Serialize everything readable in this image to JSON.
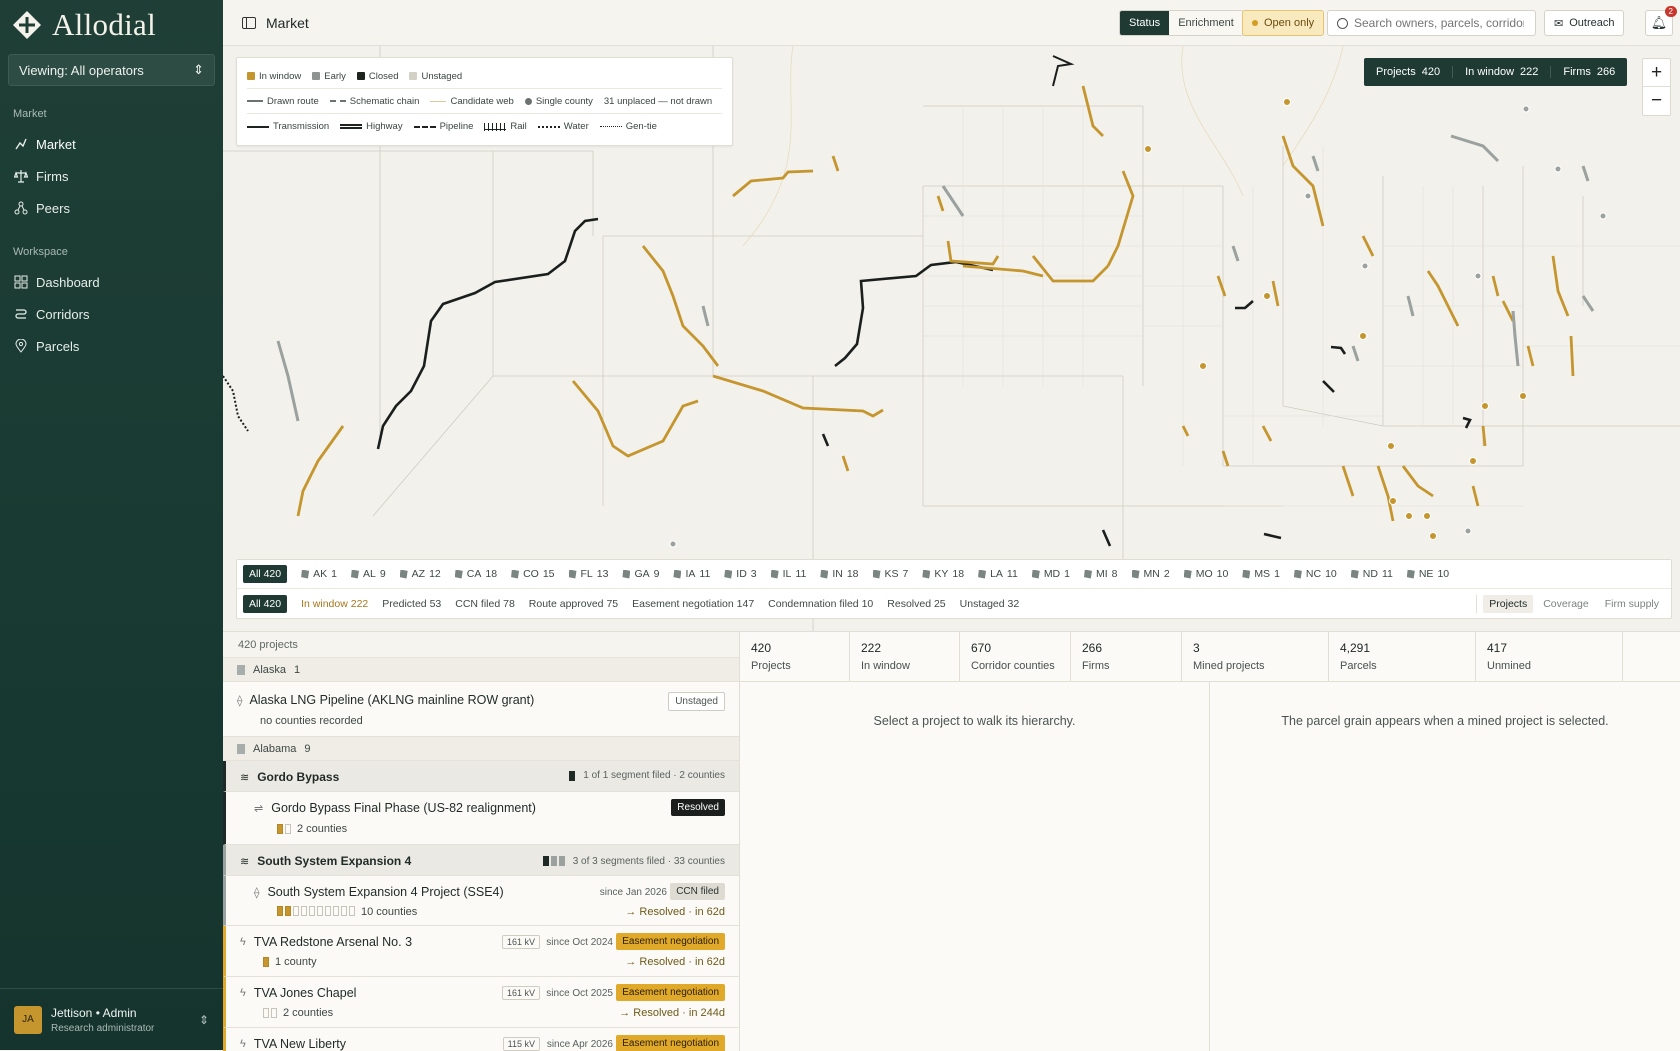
{
  "app": {
    "name": "Allodial",
    "viewing": "Viewing: All operators"
  },
  "nav": {
    "market_section": "Market",
    "workspace_section": "Workspace",
    "items": [
      {
        "label": "Market",
        "icon": "market-icon"
      },
      {
        "label": "Firms",
        "icon": "scale-icon"
      },
      {
        "label": "Peers",
        "icon": "peers-icon"
      },
      {
        "label": "Dashboard",
        "icon": "dashboard-icon"
      },
      {
        "label": "Corridors",
        "icon": "corridors-icon"
      },
      {
        "label": "Parcels",
        "icon": "pin-icon"
      }
    ]
  },
  "user": {
    "initials": "JA",
    "name": "Jettison • Admin",
    "role": "Research administrator"
  },
  "topbar": {
    "title": "Market",
    "mode_status": "Status",
    "mode_enrichment": "Enrichment",
    "open_only": "Open only",
    "search_placeholder": "Search owners, parcels, corridors",
    "outreach": "Outreach",
    "notifications": "2"
  },
  "legend": {
    "status": [
      "In window",
      "Early",
      "Closed",
      "Unstaged"
    ],
    "status_colors": [
      "#c5952e",
      "#8d9491",
      "#1d2420",
      "#d3d0c6"
    ],
    "shape": [
      "Drawn route",
      "Schematic chain",
      "Candidate web",
      "Single county",
      "31 unplaced — not drawn"
    ],
    "types": [
      "Transmission",
      "Highway",
      "Pipeline",
      "Rail",
      "Water",
      "Gen-tie"
    ]
  },
  "stats": {
    "projects_label": "Projects",
    "projects": "420",
    "window_label": "In window",
    "window": "222",
    "firms_label": "Firms",
    "firms": "266"
  },
  "state_filters": [
    {
      "label": "All",
      "count": "420"
    },
    {
      "label": "AK",
      "count": "1"
    },
    {
      "label": "AL",
      "count": "9"
    },
    {
      "label": "AZ",
      "count": "12"
    },
    {
      "label": "CA",
      "count": "18"
    },
    {
      "label": "CO",
      "count": "15"
    },
    {
      "label": "FL",
      "count": "13"
    },
    {
      "label": "GA",
      "count": "9"
    },
    {
      "label": "IA",
      "count": "11"
    },
    {
      "label": "ID",
      "count": "3"
    },
    {
      "label": "IL",
      "count": "11"
    },
    {
      "label": "IN",
      "count": "18"
    },
    {
      "label": "KS",
      "count": "7"
    },
    {
      "label": "KY",
      "count": "18"
    },
    {
      "label": "LA",
      "count": "11"
    },
    {
      "label": "MD",
      "count": "1"
    },
    {
      "label": "MI",
      "count": "8"
    },
    {
      "label": "MN",
      "count": "2"
    },
    {
      "label": "MO",
      "count": "10"
    },
    {
      "label": "MS",
      "count": "1"
    },
    {
      "label": "NC",
      "count": "10"
    },
    {
      "label": "ND",
      "count": "11"
    },
    {
      "label": "NE",
      "count": "10"
    }
  ],
  "stage_filters": [
    {
      "label": "All",
      "count": "420"
    },
    {
      "label": "In window",
      "count": "222"
    },
    {
      "label": "Predicted",
      "count": "53"
    },
    {
      "label": "CCN filed",
      "count": "78"
    },
    {
      "label": "Route approved",
      "count": "75"
    },
    {
      "label": "Easement negotiation",
      "count": "147"
    },
    {
      "label": "Condemnation filed",
      "count": "10"
    },
    {
      "label": "Resolved",
      "count": "25"
    },
    {
      "label": "Unstaged",
      "count": "32"
    }
  ],
  "view_tabs": [
    "Projects",
    "Coverage",
    "Firm supply"
  ],
  "list": {
    "count": "420 projects",
    "groups": [
      {
        "state": "Alaska",
        "count": "1"
      },
      {
        "state": "Alabama",
        "count": "9"
      }
    ],
    "alaska_item": {
      "title": "Alaska LNG Pipeline (AKLNG mainline ROW grant)",
      "badge": "Unstaged",
      "sub": "no counties recorded"
    },
    "gordo_parent": {
      "title": "Gordo Bypass",
      "meta": "1 of 1 segment filed · 2 counties"
    },
    "gordo_child": {
      "title": "Gordo Bypass Final Phase (US-82 realignment)",
      "badge": "Resolved",
      "sub": "2 counties"
    },
    "sse_parent": {
      "title": "South System Expansion 4",
      "meta": "3 of 3 segments filed · 33 counties"
    },
    "sse_child": {
      "title": "South System Expansion 4 Project (SSE4)",
      "since": "since Jan 2026",
      "badge": "CCN filed",
      "sub": "10 counties",
      "res": "→ Resolved · in 62d"
    },
    "tva1": {
      "title": "TVA Redstone Arsenal No. 3",
      "kv": "161 kV",
      "since": "since Oct 2024",
      "badge": "Easement negotiation",
      "sub": "1 county",
      "res": "→ Resolved · in 62d"
    },
    "tva2": {
      "title": "TVA Jones Chapel",
      "kv": "161 kV",
      "since": "since Oct 2025",
      "badge": "Easement negotiation",
      "sub": "2 counties",
      "res": "→ Resolved · in 244d"
    },
    "tva3": {
      "title": "TVA New Liberty",
      "kv": "115 kV",
      "since": "since Apr 2026",
      "badge": "Easement negotiation"
    }
  },
  "metrics": [
    {
      "value": "420",
      "label": "Projects"
    },
    {
      "value": "222",
      "label": "In window"
    },
    {
      "value": "670",
      "label": "Corridor counties"
    },
    {
      "value": "266",
      "label": "Firms"
    },
    {
      "value": "3",
      "label": "Mined projects"
    },
    {
      "value": "4,291",
      "label": "Parcels"
    },
    {
      "value": "417",
      "label": "Unmined"
    }
  ],
  "detail_hint": "Select a project to walk its hierarchy.",
  "parcel_hint": "The parcel grain appears when a mined project is selected."
}
